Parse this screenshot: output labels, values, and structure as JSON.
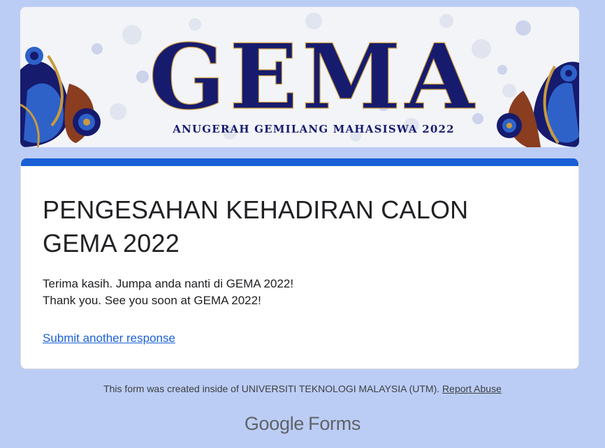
{
  "banner": {
    "title": "GEMA",
    "subtitle": "ANUGERAH GEMILANG MAHASISWA 2022",
    "colors": {
      "navy": "#161b6e",
      "gold": "#c99a3e",
      "blue": "#2e62c9",
      "bg": "#f3f4f8"
    }
  },
  "card": {
    "title": "PENGESAHAN KEHADIRAN CALON GEMA 2022",
    "message_line1": "Terima kasih. Jumpa anda nanti di GEMA 2022!",
    "message_line2": "Thank you. See you soon at GEMA 2022!",
    "link": "Submit another response",
    "accent_color": "#1a5fd6"
  },
  "footer": {
    "text": "This form was created inside of UNIVERSITI TEKNOLOGI MALAYSIA (UTM).",
    "report_link": "Report Abuse"
  },
  "logo": {
    "google": "Google",
    "forms": "Forms"
  },
  "colors": {
    "page_bg": "#bccdf5",
    "card_bg": "#ffffff",
    "link": "#1a5fd6"
  }
}
